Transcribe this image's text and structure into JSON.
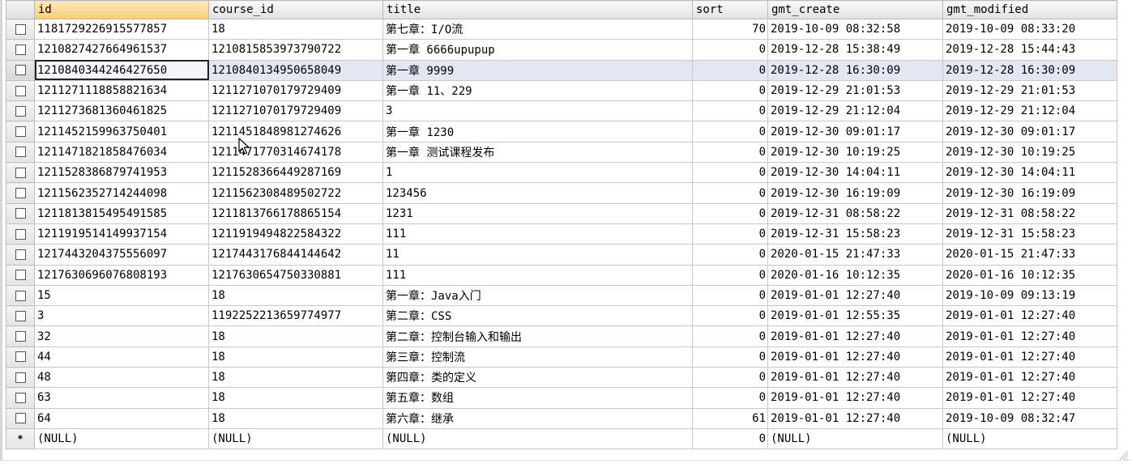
{
  "columns": {
    "sel": "",
    "id": "id",
    "course_id": "course_id",
    "title": "title",
    "sort": "sort",
    "gmt_create": "gmt_create",
    "gmt_modified": "gmt_modified"
  },
  "rows": [
    {
      "id": "1181729226915577857",
      "course_id": "18",
      "title": "第七章：I/O流",
      "sort": "70",
      "gmt_create": "2019-10-09 08:32:58",
      "gmt_modified": "2019-10-09 08:33:20"
    },
    {
      "id": "1210827427664961537",
      "course_id": "1210815853973790722",
      "title": "第一章 6666upupup",
      "sort": "0",
      "gmt_create": "2019-12-28 15:38:49",
      "gmt_modified": "2019-12-28 15:44:43"
    },
    {
      "id": "1210840344246427650",
      "course_id": "1210840134950658049",
      "title": "第一章 9999",
      "sort": "0",
      "gmt_create": "2019-12-28 16:30:09",
      "gmt_modified": "2019-12-28 16:30:09"
    },
    {
      "id": "1211271118858821634",
      "course_id": "1211271070179729409",
      "title": "第一章 11、229",
      "sort": "0",
      "gmt_create": "2019-12-29 21:01:53",
      "gmt_modified": "2019-12-29 21:01:53"
    },
    {
      "id": "1211273681360461825",
      "course_id": "1211271070179729409",
      "title": "3",
      "sort": "0",
      "gmt_create": "2019-12-29 21:12:04",
      "gmt_modified": "2019-12-29 21:12:04"
    },
    {
      "id": "1211452159963750401",
      "course_id": "1211451848981274626",
      "title": "第一章 1230",
      "sort": "0",
      "gmt_create": "2019-12-30 09:01:17",
      "gmt_modified": "2019-12-30 09:01:17"
    },
    {
      "id": "1211471821858476034",
      "course_id": "1211471770314674178",
      "title": "第一章 测试课程发布",
      "sort": "0",
      "gmt_create": "2019-12-30 10:19:25",
      "gmt_modified": "2019-12-30 10:19:25"
    },
    {
      "id": "1211528386879741953",
      "course_id": "1211528366449287169",
      "title": "1",
      "sort": "0",
      "gmt_create": "2019-12-30 14:04:11",
      "gmt_modified": "2019-12-30 14:04:11"
    },
    {
      "id": "1211562352714244098",
      "course_id": "1211562308489502722",
      "title": "123456",
      "sort": "0",
      "gmt_create": "2019-12-30 16:19:09",
      "gmt_modified": "2019-12-30 16:19:09"
    },
    {
      "id": "1211813815495491585",
      "course_id": "1211813766178865154",
      "title": "1231",
      "sort": "0",
      "gmt_create": "2019-12-31 08:58:22",
      "gmt_modified": "2019-12-31 08:58:22"
    },
    {
      "id": "1211919514149937154",
      "course_id": "1211919494822584322",
      "title": "111",
      "sort": "0",
      "gmt_create": "2019-12-31 15:58:23",
      "gmt_modified": "2019-12-31 15:58:23"
    },
    {
      "id": "1217443204375556097",
      "course_id": "1217443176844144642",
      "title": "11",
      "sort": "0",
      "gmt_create": "2020-01-15 21:47:33",
      "gmt_modified": "2020-01-15 21:47:33"
    },
    {
      "id": "1217630696076808193",
      "course_id": "1217630654750330881",
      "title": "111",
      "sort": "0",
      "gmt_create": "2020-01-16 10:12:35",
      "gmt_modified": "2020-01-16 10:12:35"
    },
    {
      "id": "15",
      "course_id": "18",
      "title": "第一章：Java入门",
      "sort": "0",
      "gmt_create": "2019-01-01 12:27:40",
      "gmt_modified": "2019-10-09 09:13:19"
    },
    {
      "id": "3",
      "course_id": "1192252213659774977",
      "title": "第二章：CSS",
      "sort": "0",
      "gmt_create": "2019-01-01 12:55:35",
      "gmt_modified": "2019-01-01 12:27:40"
    },
    {
      "id": "32",
      "course_id": "18",
      "title": "第二章：控制台输入和输出",
      "sort": "0",
      "gmt_create": "2019-01-01 12:27:40",
      "gmt_modified": "2019-01-01 12:27:40"
    },
    {
      "id": "44",
      "course_id": "18",
      "title": "第三章：控制流",
      "sort": "0",
      "gmt_create": "2019-01-01 12:27:40",
      "gmt_modified": "2019-01-01 12:27:40"
    },
    {
      "id": "48",
      "course_id": "18",
      "title": "第四章：类的定义",
      "sort": "0",
      "gmt_create": "2019-01-01 12:27:40",
      "gmt_modified": "2019-01-01 12:27:40"
    },
    {
      "id": "63",
      "course_id": "18",
      "title": "第五章：数组",
      "sort": "0",
      "gmt_create": "2019-01-01 12:27:40",
      "gmt_modified": "2019-01-01 12:27:40"
    },
    {
      "id": "64",
      "course_id": "18",
      "title": "第六章：继承",
      "sort": "61",
      "gmt_create": "2019-01-01 12:27:40",
      "gmt_modified": "2019-10-09 08:32:47"
    }
  ],
  "new_row": {
    "marker": "*",
    "id": "(NULL)",
    "course_id": "(NULL)",
    "title": "(NULL)",
    "sort": "0",
    "gmt_create": "(NULL)",
    "gmt_modified": "(NULL)"
  },
  "highlighted_row_index": 2,
  "icons": {
    "row_checkbox": "checkbox-icon",
    "cursor": "mouse-pointer-icon"
  },
  "colors": {
    "sorted_header": "#f6cd7a",
    "highlight_row": "#e3e7f3"
  }
}
